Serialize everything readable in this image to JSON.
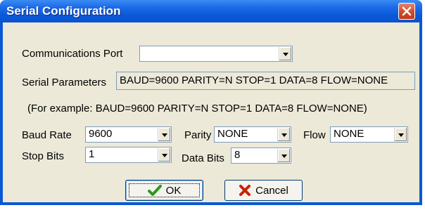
{
  "window": {
    "title": "Serial Configuration",
    "close_icon": "close-icon"
  },
  "labels": {
    "comm_port": "Communications Port",
    "serial_params": "Serial Parameters",
    "example": "(For example: BAUD=9600 PARITY=N STOP=1 DATA=8 FLOW=NONE)",
    "baud": "Baud Rate",
    "parity": "Parity",
    "flow": "Flow",
    "stop": "Stop Bits",
    "data": "Data Bits"
  },
  "fields": {
    "comm_port": "",
    "serial_params": "BAUD=9600 PARITY=N STOP=1 DATA=8 FLOW=NONE",
    "baud": "9600",
    "parity": "NONE",
    "flow": "NONE",
    "stop": "1",
    "data": "8"
  },
  "buttons": {
    "ok": "OK",
    "cancel": "Cancel"
  },
  "colors": {
    "title_bar": "#0858d8",
    "close": "#d04a28",
    "ok_icon": "#2a9a1a",
    "cancel_icon": "#cc2000"
  }
}
